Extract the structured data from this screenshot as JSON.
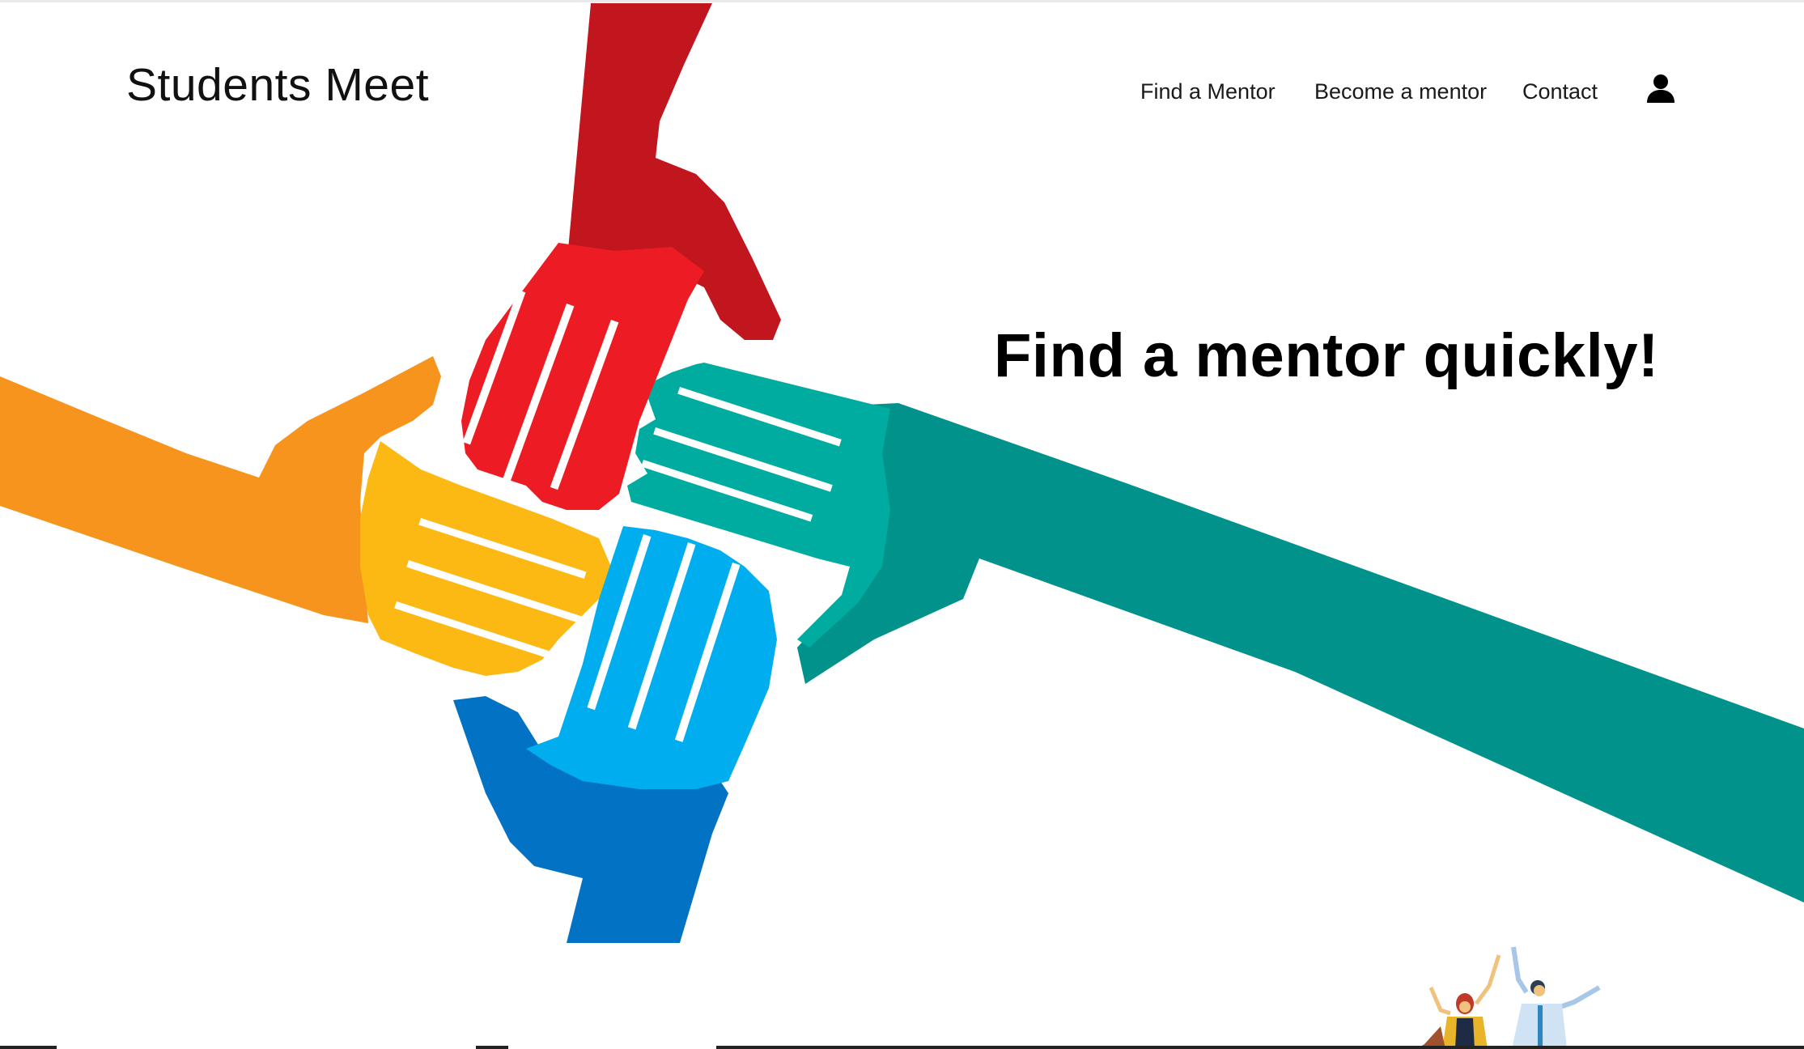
{
  "header": {
    "logo": "Students Meet",
    "nav": [
      {
        "label": "Find a Mentor"
      },
      {
        "label": "Become a mentor"
      },
      {
        "label": "Contact"
      }
    ],
    "user_icon": "user-icon"
  },
  "hero": {
    "headline": "Find a mentor quickly!",
    "illustration": "four-hands-joined",
    "colors": {
      "red": "#ed1c24",
      "red_arm": "#c1161d",
      "orange": "#f7941e",
      "yellow": "#fdb913",
      "teal": "#00a99d",
      "teal_arm": "#00928b",
      "blue": "#00aeef",
      "blue_arm": "#0273c4"
    }
  },
  "footer_illustration": "celebrating-people"
}
